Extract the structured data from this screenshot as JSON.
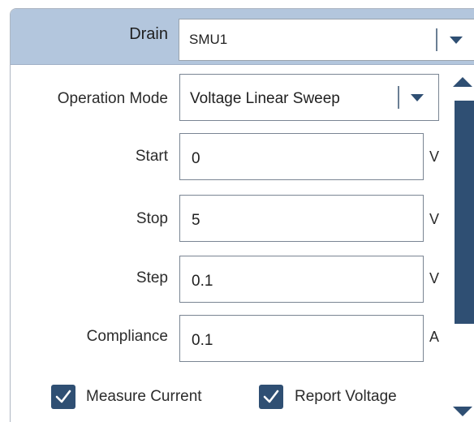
{
  "drain": {
    "label": "Drain",
    "value": "SMU1"
  },
  "operation_mode": {
    "label": "Operation Mode",
    "value": "Voltage Linear Sweep"
  },
  "start": {
    "label": "Start",
    "value": "0",
    "unit": "V"
  },
  "stop": {
    "label": "Stop",
    "value": "5",
    "unit": "V"
  },
  "step": {
    "label": "Step",
    "value": "0.1",
    "unit": "V"
  },
  "compliance": {
    "label": "Compliance",
    "value": "0.1",
    "unit": "A"
  },
  "measure_current": {
    "label": "Measure Current",
    "checked": true
  },
  "report_voltage": {
    "label": "Report Voltage",
    "checked": true
  },
  "colors": {
    "header_bg": "#b3c6dd",
    "accent": "#2f4f73",
    "border": "#7a8593"
  },
  "icons": {
    "dropdown": "chevron-down-icon",
    "check": "checkmark-icon",
    "scroll_up": "arrow-up-icon",
    "scroll_down": "arrow-down-icon"
  }
}
